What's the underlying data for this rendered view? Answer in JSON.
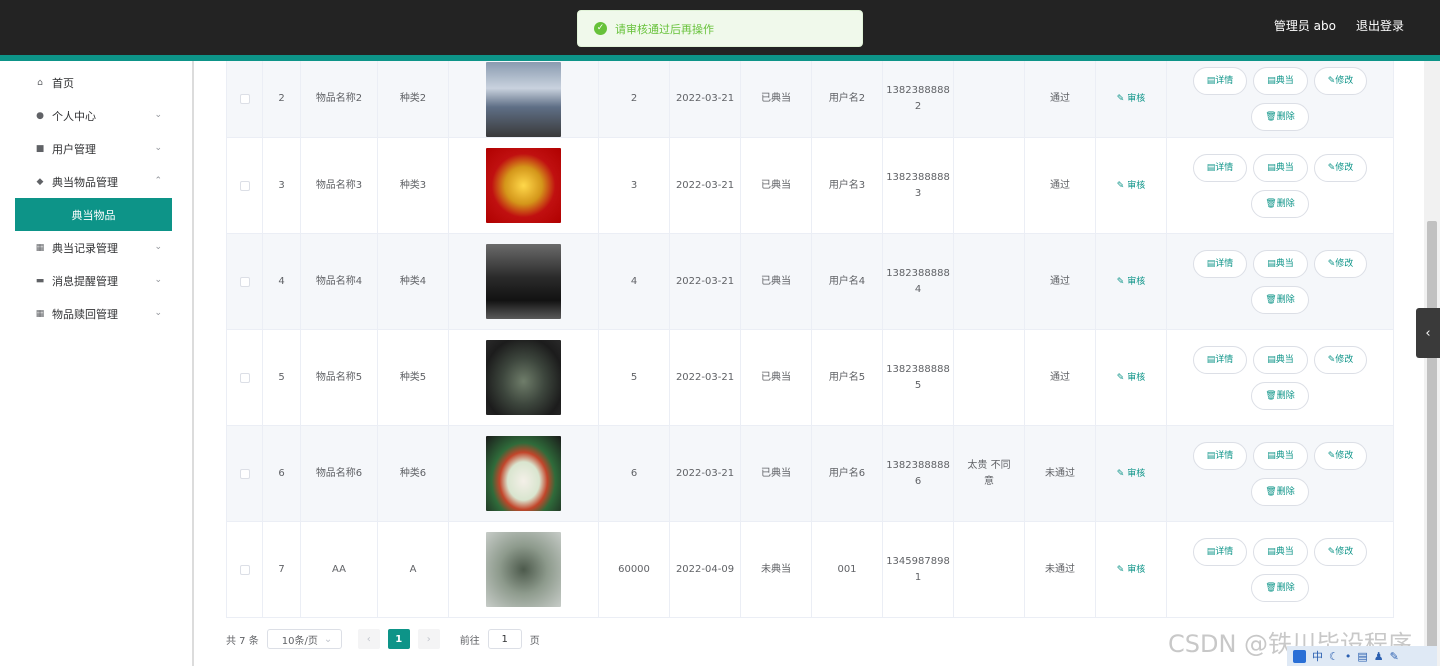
{
  "header": {
    "user_label": "管理员 abo",
    "logout_label": "退出登录"
  },
  "toast": {
    "icon": "check-circle-icon",
    "message": "请审核通过后再操作"
  },
  "sidebar": {
    "items": [
      {
        "label": "首页",
        "icon": "home-icon"
      },
      {
        "label": "个人中心",
        "icon": "user-icon"
      },
      {
        "label": "用户管理",
        "icon": "clipboard-icon"
      },
      {
        "label": "典当物品管理",
        "icon": "location-icon"
      },
      {
        "label": "典当记录管理",
        "icon": "grid-icon"
      },
      {
        "label": "消息提醒管理",
        "icon": "message-icon"
      },
      {
        "label": "物品赎回管理",
        "icon": "grid-icon"
      }
    ],
    "active_sub": "典当物品"
  },
  "buttons": {
    "detail": "详情",
    "pawn": "典当",
    "edit": "修改",
    "delete": "删除",
    "audit": "审核"
  },
  "rows": [
    {
      "idx": "2",
      "name": "物品名称2",
      "type": "种类2",
      "image": "car-silver",
      "amount": "2",
      "date": "2022-03-21",
      "status": "已典当",
      "user": "用户名2",
      "phone": "1382388888\n2",
      "reply": "",
      "review": "通过"
    },
    {
      "idx": "3",
      "name": "物品名称3",
      "type": "种类3",
      "image": "gold-bracelet",
      "amount": "3",
      "date": "2022-03-21",
      "status": "已典当",
      "user": "用户名3",
      "phone": "1382388888\n3",
      "reply": "",
      "review": "通过"
    },
    {
      "idx": "4",
      "name": "物品名称4",
      "type": "种类4",
      "image": "car-black",
      "amount": "4",
      "date": "2022-03-21",
      "status": "已典当",
      "user": "用户名4",
      "phone": "1382388888\n4",
      "reply": "",
      "review": "通过"
    },
    {
      "idx": "5",
      "name": "物品名称5",
      "type": "种类5",
      "image": "bronze-statue",
      "amount": "5",
      "date": "2022-03-21",
      "status": "已典当",
      "user": "用户名5",
      "phone": "1382388888\n5",
      "reply": "",
      "review": "通过"
    },
    {
      "idx": "6",
      "name": "物品名称6",
      "type": "种类6",
      "image": "porcelain-jar",
      "amount": "6",
      "date": "2022-03-21",
      "status": "已典当",
      "user": "用户名6",
      "phone": "1382388888\n6",
      "reply": "太贵 不同\n意",
      "review": "未通过"
    },
    {
      "idx": "7",
      "name": "AA",
      "type": "A",
      "image": "bronze-horse",
      "amount": "60000",
      "date": "2022-04-09",
      "status": "未典当",
      "user": "001",
      "phone": "1345987898\n1",
      "reply": "",
      "review": "未通过"
    }
  ],
  "pagination": {
    "total": "共 7 条",
    "page_size": "10条/页",
    "current": "1",
    "goto_label": "前往",
    "goto_value": "1",
    "page_unit": "页"
  },
  "watermark": "CSDN @铁川毕设程序",
  "tray": "中"
}
